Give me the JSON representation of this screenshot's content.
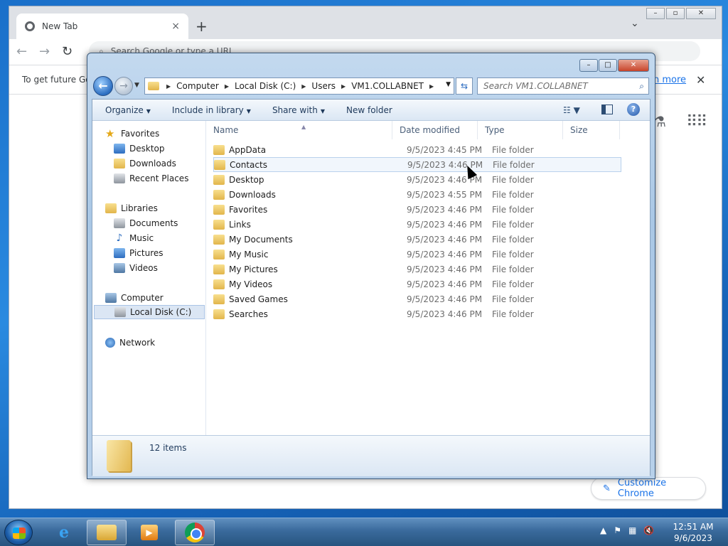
{
  "chrome": {
    "tab_title": "New Tab",
    "tab_close": "×",
    "new_tab": "+",
    "omnibox_placeholder": "Search Google or type a URL",
    "info_text": "To get future Go",
    "learn_more": "n more",
    "customize": "Customize Chrome"
  },
  "explorer": {
    "breadcrumbs": [
      "Computer",
      "Local Disk (C:)",
      "Users",
      "VM1.COLLABNET"
    ],
    "search_placeholder": "Search VM1.COLLABNET",
    "commands": {
      "organize": "Organize",
      "include": "Include in library",
      "share": "Share with",
      "new_folder": "New folder"
    },
    "nav": {
      "favorites": "Favorites",
      "desktop": "Desktop",
      "downloads": "Downloads",
      "recent": "Recent Places",
      "libraries": "Libraries",
      "documents": "Documents",
      "music": "Music",
      "pictures": "Pictures",
      "videos": "Videos",
      "computer": "Computer",
      "local_disk": "Local Disk (C:)",
      "network": "Network"
    },
    "columns": {
      "name": "Name",
      "date": "Date modified",
      "type": "Type",
      "size": "Size"
    },
    "files": [
      {
        "name": "AppData",
        "date": "9/5/2023 4:45 PM",
        "type": "File folder"
      },
      {
        "name": "Contacts",
        "date": "9/5/2023 4:46 PM",
        "type": "File folder"
      },
      {
        "name": "Desktop",
        "date": "9/5/2023 4:46 PM",
        "type": "File folder"
      },
      {
        "name": "Downloads",
        "date": "9/5/2023 4:55 PM",
        "type": "File folder"
      },
      {
        "name": "Favorites",
        "date": "9/5/2023 4:46 PM",
        "type": "File folder"
      },
      {
        "name": "Links",
        "date": "9/5/2023 4:46 PM",
        "type": "File folder"
      },
      {
        "name": "My Documents",
        "date": "9/5/2023 4:46 PM",
        "type": "File folder"
      },
      {
        "name": "My Music",
        "date": "9/5/2023 4:46 PM",
        "type": "File folder"
      },
      {
        "name": "My Pictures",
        "date": "9/5/2023 4:46 PM",
        "type": "File folder"
      },
      {
        "name": "My Videos",
        "date": "9/5/2023 4:46 PM",
        "type": "File folder"
      },
      {
        "name": "Saved Games",
        "date": "9/5/2023 4:46 PM",
        "type": "File folder"
      },
      {
        "name": "Searches",
        "date": "9/5/2023 4:46 PM",
        "type": "File folder"
      }
    ],
    "item_count": "12 items"
  },
  "taskbar": {
    "time": "12:51 AM",
    "date": "9/6/2023"
  }
}
